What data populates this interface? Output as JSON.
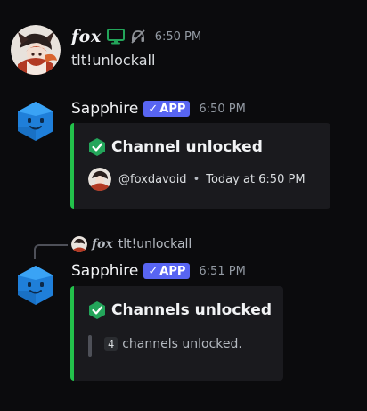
{
  "messages": [
    {
      "author": "fox",
      "timestamp": "6:50 PM",
      "content": "tlt!unlockall",
      "icons": [
        "monitor-icon",
        "deafened-icon"
      ],
      "colors": {
        "monitor": "#23a55a",
        "deafened": "#8e9297"
      }
    },
    {
      "author": "Sapphire",
      "badge": "APP",
      "timestamp": "6:50 PM",
      "embed": {
        "title": "Channel unlocked",
        "footer_user": "@foxdavoid",
        "footer_time": "Today at 6:50 PM",
        "color": "#23c14b"
      }
    },
    {
      "reply_to": {
        "author": "fox",
        "content": "tlt!unlockall"
      },
      "author": "Sapphire",
      "badge": "APP",
      "timestamp": "6:51 PM",
      "embed": {
        "title": "Channels unlocked",
        "count": "4",
        "description": "channels unlocked.",
        "color": "#23c14b"
      }
    }
  ],
  "colors": {
    "background": "#0b0b0d",
    "embed_bg": "#1a1a1e",
    "app_badge": "#5865f2",
    "timestamp": "#949ba4"
  }
}
